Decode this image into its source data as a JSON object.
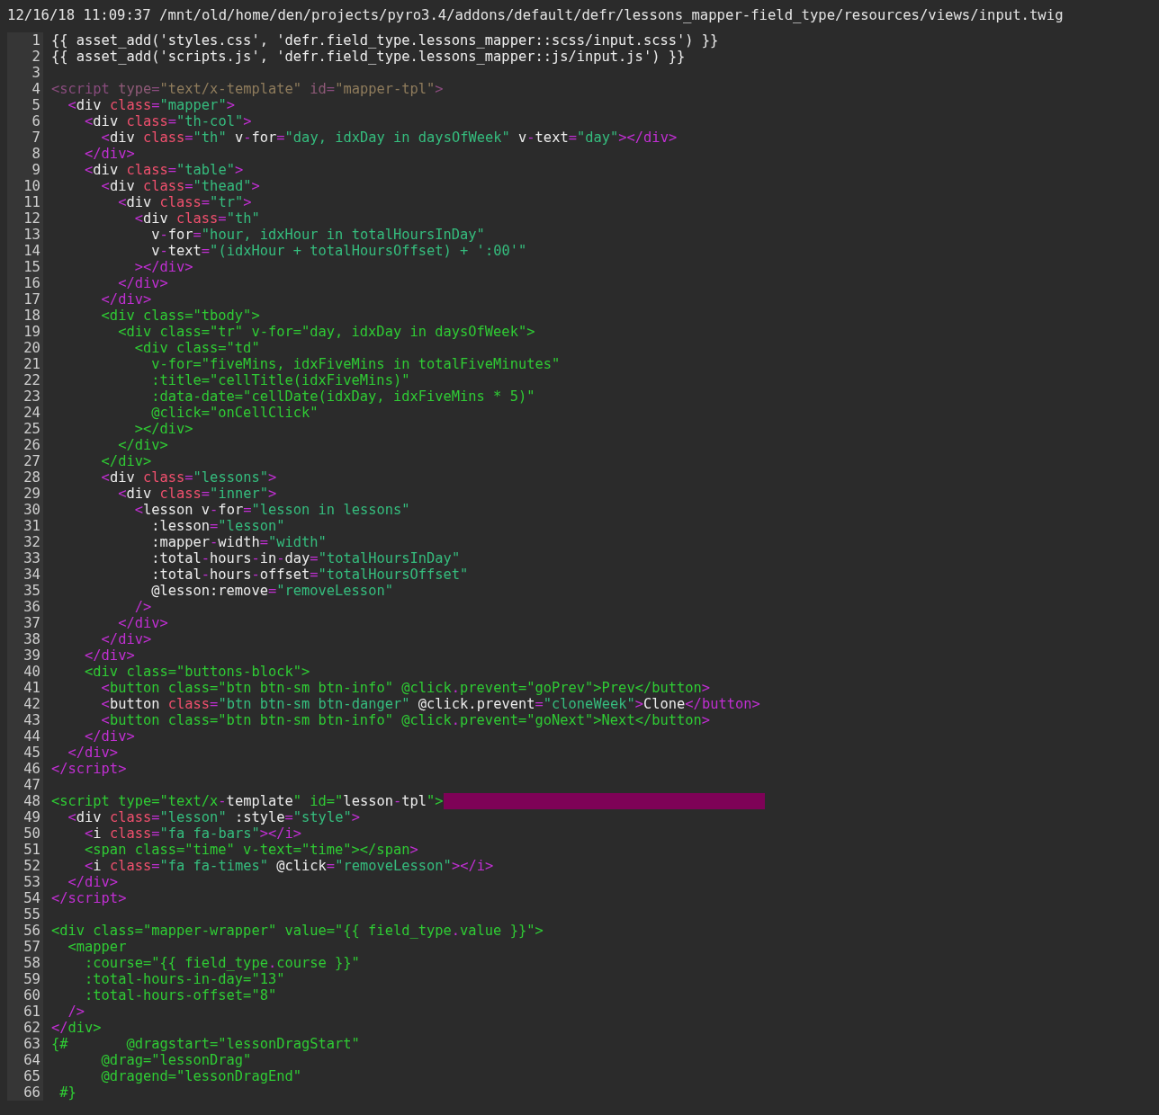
{
  "title": "12/16/18 11:09:37 /mnt/old/home/den/projects/pyro3.4/addons/default/defr/lessons_mapper-field_type/resources/views/input.twig",
  "lines": [
    {
      "number": "1",
      "tokens": [
        {
          "kind": "tag",
          "text": "{{ asset_add('styles.css', 'defr.field_type.lessons_mapper::scss/input.scss') }}"
        }
      ]
    },
    {
      "number": "2",
      "tokens": [
        {
          "kind": "tag",
          "text": "{{ asset_add('scripts.js', 'defr.field_type.lessons_mapper::js/input.js') }}"
        }
      ]
    },
    {
      "number": "3"
    },
    {
      "number": "4",
      "tokens": [
        {
          "kind": "dimpunct",
          "text": "<script "
        },
        {
          "kind": "dimattr",
          "text": "type"
        },
        {
          "kind": "dimpunct",
          "text": "="
        },
        {
          "kind": "dimstring",
          "text": "\"text/x-template\""
        },
        {
          "kind": "dimattr",
          "text": " id"
        },
        {
          "kind": "dimpunct",
          "text": "="
        },
        {
          "kind": "dimstring",
          "text": "\"mapper-tpl\""
        },
        {
          "kind": "dimpunct",
          "text": ">"
        }
      ]
    },
    {
      "number": "5",
      "tokens": [
        {
          "kind": "punct",
          "text": "  <"
        },
        {
          "kind": "tag",
          "text": "div "
        },
        {
          "kind": "attr",
          "text": "class"
        },
        {
          "kind": "punct",
          "text": "="
        },
        {
          "kind": "string",
          "text": "\"mapper\""
        },
        {
          "kind": "punct",
          "text": ">"
        }
      ]
    },
    {
      "number": "6",
      "tokens": [
        {
          "kind": "punct",
          "text": "    <"
        },
        {
          "kind": "tag",
          "text": "div "
        },
        {
          "kind": "attr",
          "text": "class"
        },
        {
          "kind": "punct",
          "text": "="
        },
        {
          "kind": "string",
          "text": "\"th-col\""
        },
        {
          "kind": "punct",
          "text": ">"
        }
      ]
    },
    {
      "number": "7",
      "tokens": [
        {
          "kind": "punct",
          "text": "      <"
        },
        {
          "kind": "tag",
          "text": "div "
        },
        {
          "kind": "attr",
          "text": "class"
        },
        {
          "kind": "punct",
          "text": "="
        },
        {
          "kind": "string",
          "text": "\"th\""
        },
        {
          "kind": "tag",
          "text": " v"
        },
        {
          "kind": "punct",
          "text": "-"
        },
        {
          "kind": "tag",
          "text": "for"
        },
        {
          "kind": "punct",
          "text": "="
        },
        {
          "kind": "string",
          "text": "\"day, idxDay in daysOfWeek\""
        },
        {
          "kind": "tag",
          "text": " v"
        },
        {
          "kind": "punct",
          "text": "-"
        },
        {
          "kind": "tag",
          "text": "text"
        },
        {
          "kind": "punct",
          "text": "="
        },
        {
          "kind": "string",
          "text": "\"day\""
        },
        {
          "kind": "punct",
          "text": "></div>"
        }
      ]
    },
    {
      "number": "8",
      "tokens": [
        {
          "kind": "punct",
          "text": "    </div>"
        }
      ]
    },
    {
      "number": "9",
      "tokens": [
        {
          "kind": "punct",
          "text": "    <"
        },
        {
          "kind": "tag",
          "text": "div "
        },
        {
          "kind": "attr",
          "text": "class"
        },
        {
          "kind": "punct",
          "text": "="
        },
        {
          "kind": "string",
          "text": "\"table\""
        },
        {
          "kind": "punct",
          "text": ">"
        }
      ]
    },
    {
      "number": "10",
      "tokens": [
        {
          "kind": "punct",
          "text": "      <"
        },
        {
          "kind": "tag",
          "text": "div "
        },
        {
          "kind": "attr",
          "text": "class"
        },
        {
          "kind": "punct",
          "text": "="
        },
        {
          "kind": "string",
          "text": "\"thead\""
        },
        {
          "kind": "punct",
          "text": ">"
        }
      ]
    },
    {
      "number": "11",
      "tokens": [
        {
          "kind": "punct",
          "text": "        <"
        },
        {
          "kind": "tag",
          "text": "div "
        },
        {
          "kind": "attr",
          "text": "class"
        },
        {
          "kind": "punct",
          "text": "="
        },
        {
          "kind": "string",
          "text": "\"tr\""
        },
        {
          "kind": "punct",
          "text": ">"
        }
      ]
    },
    {
      "number": "12",
      "tokens": [
        {
          "kind": "punct",
          "text": "          <"
        },
        {
          "kind": "tag",
          "text": "div "
        },
        {
          "kind": "attr",
          "text": "class"
        },
        {
          "kind": "punct",
          "text": "="
        },
        {
          "kind": "string",
          "text": "\"th\""
        }
      ]
    },
    {
      "number": "13",
      "tokens": [
        {
          "kind": "tag",
          "text": "            v"
        },
        {
          "kind": "punct",
          "text": "-"
        },
        {
          "kind": "tag",
          "text": "for"
        },
        {
          "kind": "punct",
          "text": "="
        },
        {
          "kind": "string",
          "text": "\"hour, idxHour in totalHoursInDay\""
        }
      ]
    },
    {
      "number": "14",
      "tokens": [
        {
          "kind": "tag",
          "text": "            v"
        },
        {
          "kind": "punct",
          "text": "-"
        },
        {
          "kind": "tag",
          "text": "text"
        },
        {
          "kind": "punct",
          "text": "="
        },
        {
          "kind": "string",
          "text": "\"(idxHour + totalHoursOffset) + ':00'\""
        }
      ]
    },
    {
      "number": "15",
      "tokens": [
        {
          "kind": "punct",
          "text": "          ></div>"
        }
      ]
    },
    {
      "number": "16",
      "tokens": [
        {
          "kind": "punct",
          "text": "        </div>"
        }
      ]
    },
    {
      "number": "17",
      "tokens": [
        {
          "kind": "punct",
          "text": "      </div>"
        }
      ]
    },
    {
      "number": "18",
      "tokens": [
        {
          "kind": "plain",
          "text": "      <div class=\"tbody\">"
        }
      ]
    },
    {
      "number": "19",
      "tokens": [
        {
          "kind": "plain",
          "text": "        <div class=\"tr\" v-for=\"day, idxDay in daysOfWeek\">"
        }
      ]
    },
    {
      "number": "20",
      "tokens": [
        {
          "kind": "plain",
          "text": "          <div class=\"td\""
        }
      ]
    },
    {
      "number": "21",
      "tokens": [
        {
          "kind": "plain",
          "text": "            v-for=\"fiveMins, idxFiveMins in totalFiveMinutes\""
        }
      ]
    },
    {
      "number": "22",
      "tokens": [
        {
          "kind": "plain",
          "text": "            :title=\"cellTitle(idxFiveMins)\""
        }
      ]
    },
    {
      "number": "23",
      "tokens": [
        {
          "kind": "plain",
          "text": "            :data-date=\"cellDate(idxDay, idxFiveMins * 5)\""
        }
      ]
    },
    {
      "number": "24",
      "tokens": [
        {
          "kind": "plain",
          "text": "            @click=\"onCellClick\""
        }
      ]
    },
    {
      "number": "25",
      "tokens": [
        {
          "kind": "plain",
          "text": "          ></div>"
        }
      ]
    },
    {
      "number": "26",
      "tokens": [
        {
          "kind": "plain",
          "text": "        </div>"
        }
      ]
    },
    {
      "number": "27",
      "tokens": [
        {
          "kind": "plain",
          "text": "      </div>"
        }
      ]
    },
    {
      "number": "28",
      "tokens": [
        {
          "kind": "punct",
          "text": "      <"
        },
        {
          "kind": "tag",
          "text": "div "
        },
        {
          "kind": "attr",
          "text": "class"
        },
        {
          "kind": "punct",
          "text": "="
        },
        {
          "kind": "string",
          "text": "\"lessons\""
        },
        {
          "kind": "punct",
          "text": ">"
        }
      ]
    },
    {
      "number": "29",
      "tokens": [
        {
          "kind": "punct",
          "text": "        <"
        },
        {
          "kind": "tag",
          "text": "div "
        },
        {
          "kind": "attr",
          "text": "class"
        },
        {
          "kind": "punct",
          "text": "="
        },
        {
          "kind": "string",
          "text": "\"inner\""
        },
        {
          "kind": "punct",
          "text": ">"
        }
      ]
    },
    {
      "number": "30",
      "tokens": [
        {
          "kind": "punct",
          "text": "          <"
        },
        {
          "kind": "tag",
          "text": "lesson v"
        },
        {
          "kind": "punct",
          "text": "-"
        },
        {
          "kind": "tag",
          "text": "for"
        },
        {
          "kind": "punct",
          "text": "="
        },
        {
          "kind": "string",
          "text": "\"lesson in lessons\""
        }
      ]
    },
    {
      "number": "31",
      "tokens": [
        {
          "kind": "tag",
          "text": "            :lesson"
        },
        {
          "kind": "punct",
          "text": "="
        },
        {
          "kind": "string",
          "text": "\"lesson\""
        }
      ]
    },
    {
      "number": "32",
      "tokens": [
        {
          "kind": "tag",
          "text": "            :mapper"
        },
        {
          "kind": "punct",
          "text": "-"
        },
        {
          "kind": "tag",
          "text": "width"
        },
        {
          "kind": "punct",
          "text": "="
        },
        {
          "kind": "string",
          "text": "\"width\""
        }
      ]
    },
    {
      "number": "33",
      "tokens": [
        {
          "kind": "tag",
          "text": "            :total"
        },
        {
          "kind": "punct",
          "text": "-"
        },
        {
          "kind": "tag",
          "text": "hours"
        },
        {
          "kind": "punct",
          "text": "-"
        },
        {
          "kind": "tag",
          "text": "in"
        },
        {
          "kind": "punct",
          "text": "-"
        },
        {
          "kind": "tag",
          "text": "day"
        },
        {
          "kind": "punct",
          "text": "="
        },
        {
          "kind": "string",
          "text": "\"totalHoursInDay\""
        }
      ]
    },
    {
      "number": "34",
      "tokens": [
        {
          "kind": "tag",
          "text": "            :total"
        },
        {
          "kind": "punct",
          "text": "-"
        },
        {
          "kind": "tag",
          "text": "hours"
        },
        {
          "kind": "punct",
          "text": "-"
        },
        {
          "kind": "tag",
          "text": "offset"
        },
        {
          "kind": "punct",
          "text": "="
        },
        {
          "kind": "string",
          "text": "\"totalHoursOffset\""
        }
      ]
    },
    {
      "number": "35",
      "tokens": [
        {
          "kind": "tag",
          "text": "            @lesson:remove"
        },
        {
          "kind": "punct",
          "text": "="
        },
        {
          "kind": "string",
          "text": "\"removeLesson\""
        }
      ]
    },
    {
      "number": "36",
      "tokens": [
        {
          "kind": "punct",
          "text": "          />"
        }
      ]
    },
    {
      "number": "37",
      "tokens": [
        {
          "kind": "punct",
          "text": "        </div>"
        }
      ]
    },
    {
      "number": "38",
      "tokens": [
        {
          "kind": "punct",
          "text": "      </div>"
        }
      ]
    },
    {
      "number": "39",
      "tokens": [
        {
          "kind": "punct",
          "text": "    </div>"
        }
      ]
    },
    {
      "number": "40",
      "tokens": [
        {
          "kind": "plain",
          "text": "    <div class=\"buttons-block\">"
        }
      ]
    },
    {
      "number": "41",
      "tokens": [
        {
          "kind": "punct",
          "text": "      <"
        },
        {
          "kind": "plain",
          "text": "button class=\"btn btn-sm btn-info\" @click"
        },
        {
          "kind": "punct",
          "text": "."
        },
        {
          "kind": "plain",
          "text": "prevent=\"goPrev\">Prev</button"
        },
        {
          "kind": "punct",
          "text": ">"
        }
      ]
    },
    {
      "number": "42",
      "tokens": [
        {
          "kind": "punct",
          "text": "      <"
        },
        {
          "kind": "tag",
          "text": "button "
        },
        {
          "kind": "attr",
          "text": "class"
        },
        {
          "kind": "punct",
          "text": "="
        },
        {
          "kind": "string",
          "text": "\"btn btn-sm btn-danger\""
        },
        {
          "kind": "tag",
          "text": " @click.prevent"
        },
        {
          "kind": "punct",
          "text": "="
        },
        {
          "kind": "string",
          "text": "\"cloneWeek\""
        },
        {
          "kind": "punct",
          "text": ">"
        },
        {
          "kind": "tag",
          "text": "Clone"
        },
        {
          "kind": "punct",
          "text": "</button>"
        }
      ]
    },
    {
      "number": "43",
      "tokens": [
        {
          "kind": "punct",
          "text": "      <"
        },
        {
          "kind": "plain",
          "text": "button class=\"btn btn-sm btn-info\" @click"
        },
        {
          "kind": "punct",
          "text": "."
        },
        {
          "kind": "plain",
          "text": "prevent=\"goNext\">Next</button"
        },
        {
          "kind": "punct",
          "text": ">"
        }
      ]
    },
    {
      "number": "44",
      "tokens": [
        {
          "kind": "punct",
          "text": "    </div>"
        }
      ]
    },
    {
      "number": "45",
      "tokens": [
        {
          "kind": "punct",
          "text": "  </div>"
        }
      ]
    },
    {
      "number": "46",
      "tokens": [
        {
          "kind": "punct",
          "text": "</script>"
        }
      ]
    },
    {
      "number": "47"
    },
    {
      "number": "48",
      "marked": true,
      "tokens": [
        {
          "kind": "plain",
          "text": "<script type=\"text/x"
        },
        {
          "kind": "punct",
          "text": "-"
        },
        {
          "kind": "tag",
          "text": "template"
        },
        {
          "kind": "plain",
          "text": "\" id=\""
        },
        {
          "kind": "tag",
          "text": "lesson"
        },
        {
          "kind": "punct",
          "text": "-"
        },
        {
          "kind": "tag",
          "text": "tpl"
        },
        {
          "kind": "plain",
          "text": "\">"
        }
      ]
    },
    {
      "number": "49",
      "tokens": [
        {
          "kind": "punct",
          "text": "  <"
        },
        {
          "kind": "tag",
          "text": "div "
        },
        {
          "kind": "attr",
          "text": "class"
        },
        {
          "kind": "punct",
          "text": "="
        },
        {
          "kind": "string",
          "text": "\"lesson\""
        },
        {
          "kind": "tag",
          "text": " :style"
        },
        {
          "kind": "punct",
          "text": "="
        },
        {
          "kind": "string",
          "text": "\"style\""
        },
        {
          "kind": "punct",
          "text": ">"
        }
      ]
    },
    {
      "number": "50",
      "tokens": [
        {
          "kind": "punct",
          "text": "    <"
        },
        {
          "kind": "tag",
          "text": "i "
        },
        {
          "kind": "attr",
          "text": "class"
        },
        {
          "kind": "punct",
          "text": "="
        },
        {
          "kind": "string",
          "text": "\"fa fa-bars\""
        },
        {
          "kind": "punct",
          "text": "></i>"
        }
      ]
    },
    {
      "number": "51",
      "tokens": [
        {
          "kind": "plain",
          "text": "    <span class=\"time\" v-text=\"time\"></span"
        },
        {
          "kind": "punct",
          "text": ">"
        }
      ]
    },
    {
      "number": "52",
      "tokens": [
        {
          "kind": "punct",
          "text": "    <"
        },
        {
          "kind": "tag",
          "text": "i "
        },
        {
          "kind": "attr",
          "text": "class"
        },
        {
          "kind": "punct",
          "text": "="
        },
        {
          "kind": "string",
          "text": "\"fa fa-times\""
        },
        {
          "kind": "tag",
          "text": " @click"
        },
        {
          "kind": "punct",
          "text": "="
        },
        {
          "kind": "string",
          "text": "\"removeLesson\""
        },
        {
          "kind": "punct",
          "text": "></i>"
        }
      ]
    },
    {
      "number": "53",
      "tokens": [
        {
          "kind": "punct",
          "text": "  </div>"
        }
      ]
    },
    {
      "number": "54",
      "tokens": [
        {
          "kind": "punct",
          "text": "</script>"
        }
      ]
    },
    {
      "number": "55"
    },
    {
      "number": "56",
      "tokens": [
        {
          "kind": "plain",
          "text": "<div class=\"mapper-wrapper\" value=\"{{ field_type"
        },
        {
          "kind": "punct",
          "text": "."
        },
        {
          "kind": "plain",
          "text": "value }}\">"
        }
      ]
    },
    {
      "number": "57",
      "tokens": [
        {
          "kind": "plain",
          "text": "  <mapper"
        }
      ]
    },
    {
      "number": "58",
      "tokens": [
        {
          "kind": "plain",
          "text": "    :course=\"{{ field_type"
        },
        {
          "kind": "punct",
          "text": "."
        },
        {
          "kind": "plain",
          "text": "course }}\""
        }
      ]
    },
    {
      "number": "59",
      "tokens": [
        {
          "kind": "plain",
          "text": "    :total-hours-in-day=\"13\""
        }
      ]
    },
    {
      "number": "60",
      "tokens": [
        {
          "kind": "plain",
          "text": "    :total-hours-offset=\"8\""
        }
      ]
    },
    {
      "number": "61",
      "tokens": [
        {
          "kind": "punct",
          "text": "  />"
        }
      ]
    },
    {
      "number": "62",
      "tokens": [
        {
          "kind": "punct",
          "text": "</"
        },
        {
          "kind": "plain",
          "text": "div>"
        }
      ]
    },
    {
      "number": "63",
      "tokens": [
        {
          "kind": "plain",
          "text": "{#       @dragstart=\"lessonDragStart\""
        }
      ]
    },
    {
      "number": "64",
      "tokens": [
        {
          "kind": "plain",
          "text": "      @drag=\"lessonDrag\""
        }
      ]
    },
    {
      "number": "65",
      "tokens": [
        {
          "kind": "plain",
          "text": "      @dragend=\"lessonDragEnd\""
        }
      ]
    },
    {
      "number": "66",
      "tokens": [
        {
          "kind": "plain",
          "text": " #}"
        }
      ]
    }
  ]
}
